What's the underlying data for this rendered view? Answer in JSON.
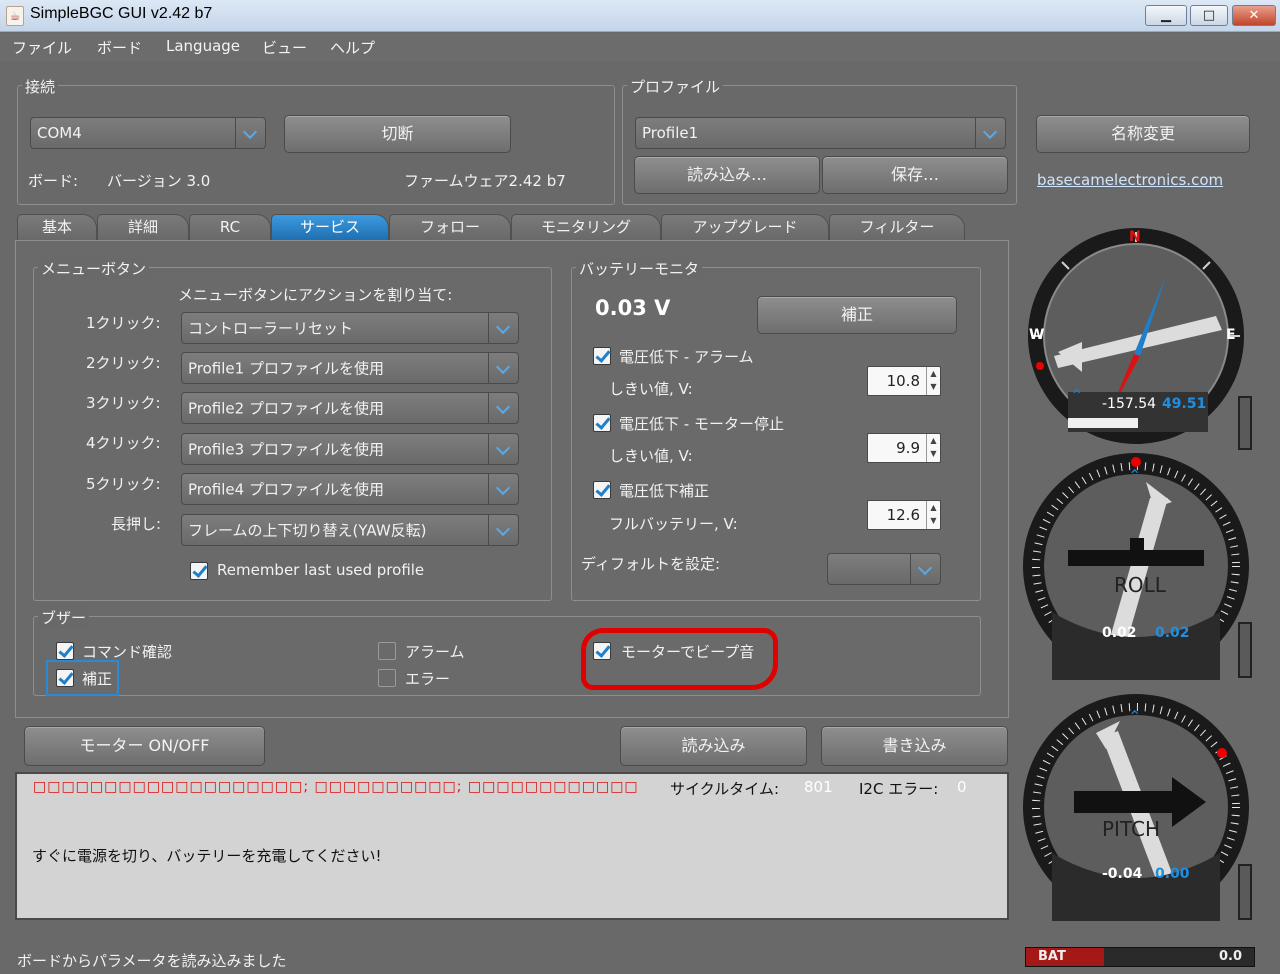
{
  "window": {
    "title": "SimpleBGC GUI v2.42 b7",
    "controls": [
      "▁",
      "□",
      "✕"
    ]
  },
  "menu": [
    "ファイル",
    "ボード",
    "Language",
    "ビュー",
    "ヘルプ"
  ],
  "connection": {
    "group_title": "接続",
    "port": "COM4",
    "disconnect_label": "切断",
    "board_label": "ボード:",
    "board_version": "バージョン 3.0",
    "firmware": "ファームウェア2.42 b7"
  },
  "profile": {
    "group_title": "プロファイル",
    "selected": "Profile1",
    "load_label": "読み込み…",
    "save_label": "保存…",
    "rename_label": "名称変更",
    "link": "basecamelectronics.com"
  },
  "tabs": [
    "基本",
    "詳細",
    "RC",
    "サービス",
    "フォロー",
    "モニタリング",
    "アップグレード",
    "フィルター"
  ],
  "menu_buttons": {
    "group_title": "メニューボタン",
    "heading": "メニューボタンにアクションを割り当て:",
    "rows": [
      {
        "label": "1クリック:",
        "value": "コントローラーリセット"
      },
      {
        "label": "2クリック:",
        "value": "Profile1 プロファイルを使用"
      },
      {
        "label": "3クリック:",
        "value": "Profile2 プロファイルを使用"
      },
      {
        "label": "4クリック:",
        "value": "Profile3 プロファイルを使用"
      },
      {
        "label": "5クリック:",
        "value": "Profile4 プロファイルを使用"
      },
      {
        "label": "長押し:",
        "value": "フレームの上下切り替え(YAW反転)"
      }
    ],
    "remember_label": "Remember last used profile"
  },
  "battery": {
    "group_title": "バッテリーモニタ",
    "voltage": "0.03 V",
    "calibrate_label": "補正",
    "low_alarm_label": "電圧低下 - アラーム",
    "low_alarm_threshold_label": "しきい値, V:",
    "low_alarm_value": "10.8",
    "low_stop_label": "電圧低下 - モーター停止",
    "low_stop_threshold_label": "しきい値, V:",
    "low_stop_value": "9.9",
    "comp_label": "電圧低下補正",
    "full_label": "フルバッテリー, V:",
    "full_value": "12.6",
    "default_label": "ディフォルトを設定:",
    "default_value": ""
  },
  "buzzer": {
    "group_title": "ブザー",
    "command_confirm": "コマンド確認",
    "calibrate": "補正",
    "alarm": "アラーム",
    "error": "エラー",
    "motor_beep": "モーターでビープ音"
  },
  "actions": {
    "motor_onoff": "モーター ON/OFF",
    "read": "読み込み",
    "write": "書き込み"
  },
  "console": {
    "error_text": "□□□□□□□□□□□□□□□□□□□; □□□□□□□□□□; □□□□□□□□□□□□",
    "cycle_label": "サイクルタイム:",
    "cycle_value": "801",
    "i2c_label": "I2C エラー:",
    "i2c_value": "0",
    "message": "すぐに電源を切り、バッテリーを充電してください!"
  },
  "status": {
    "text": "ボードからパラメータを読み込みました",
    "bat_label": "BAT",
    "bat_value": "0.0"
  },
  "gauges": {
    "compass": {
      "north": "N",
      "west": "W",
      "east": "E",
      "value": "-157.54",
      "value2": "49.51"
    },
    "roll": {
      "label": "ROLL",
      "value": "0.02",
      "value2": "0.02"
    },
    "pitch": {
      "label": "PITCH",
      "value": "-0.04",
      "value2": "0.00"
    }
  },
  "colors": {
    "accent": "#1f7fc8",
    "highlight_red": "#e00000",
    "console_bg": "#d3d3d3"
  }
}
